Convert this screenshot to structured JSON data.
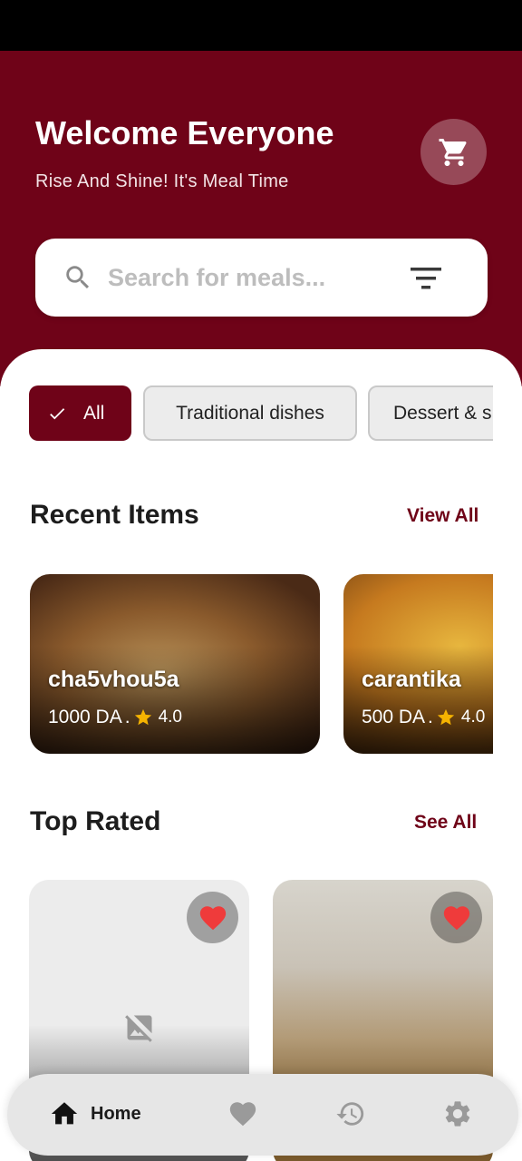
{
  "header": {
    "title": "Welcome Everyone",
    "subtitle": "Rise And Shine! It's Meal Time",
    "cart_icon": "cart-icon"
  },
  "search": {
    "placeholder": "Search for meals...",
    "value": "",
    "search_icon": "search-icon",
    "filter_icon": "filter-icon"
  },
  "categories": [
    {
      "label": "All",
      "selected": true
    },
    {
      "label": "Traditional dishes",
      "selected": false
    },
    {
      "label": "Dessert & s",
      "selected": false
    }
  ],
  "recent": {
    "title": "Recent Items",
    "link": "View All",
    "items": [
      {
        "name": "cha5vhou5a",
        "price": "1000 DA",
        "separator": ".",
        "rating": "4.0"
      },
      {
        "name": "carantika",
        "price": "500 DA",
        "separator": ".",
        "rating": "4.0"
      }
    ]
  },
  "top_rated": {
    "title": "Top Rated",
    "link": "See All",
    "items": [
      {
        "image": "broken-image-icon",
        "favorite": true
      },
      {
        "image": "photo",
        "favorite": true
      }
    ]
  },
  "nav": {
    "items": [
      {
        "label": "Home",
        "icon": "home-icon",
        "active": true
      },
      {
        "label": "",
        "icon": "heart-icon",
        "active": false
      },
      {
        "label": "",
        "icon": "history-icon",
        "active": false
      },
      {
        "label": "",
        "icon": "gear-icon",
        "active": false
      }
    ]
  },
  "colors": {
    "brand": "#6f0318",
    "star": "#f5b301",
    "favorite": "#ef3b3b"
  }
}
